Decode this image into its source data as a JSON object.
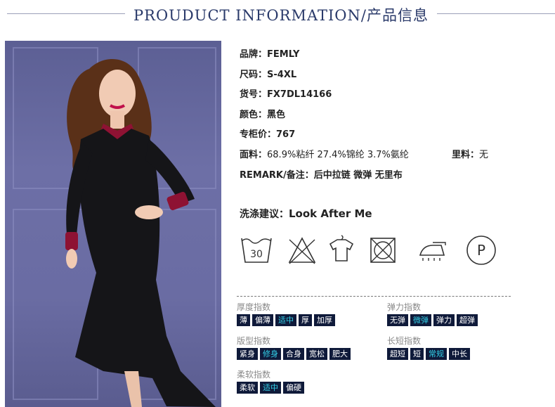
{
  "header": {
    "title": "PROUDUCT INFORMATION/产品信息"
  },
  "product": {
    "brand_label": "品牌：",
    "brand": "FEMLY",
    "size_label": "尺码：",
    "size": "S-4XL",
    "item_no_label": "货号：",
    "item_no": "FX7DL14166",
    "color_label": "颜色：",
    "color": "黑色",
    "price_label": "专柜价：",
    "price": "767",
    "fabric_label": "面料：",
    "fabric": "68.9%粘纤 27.4%锦纶 3.7%氨纶",
    "lining_label": "里料：",
    "lining": "无",
    "remark_label": "REMARK/备注：",
    "remark": "后中拉链 微弹 无里布"
  },
  "care": {
    "label": "洗涤建议：",
    "value": "Look After Me",
    "icons": [
      "wash-30-icon",
      "no-bleach-icon",
      "hang-dry-icon",
      "no-tumble-dry-icon",
      "iron-steam-icon",
      "dry-clean-p-icon"
    ],
    "wash_temp": "30",
    "dry_clean_letter": "P"
  },
  "indices": {
    "thickness": {
      "title": "厚度指数",
      "options": [
        "薄",
        "偏薄",
        "适中",
        "厚",
        "加厚"
      ],
      "selected": "适中"
    },
    "elasticity": {
      "title": "弹力指数",
      "options": [
        "无弹",
        "微弹",
        "弹力",
        "超弹"
      ],
      "selected": "微弹"
    },
    "fit": {
      "title": "版型指数",
      "options": [
        "紧身",
        "修身",
        "合身",
        "宽松",
        "肥大"
      ],
      "selected": "修身"
    },
    "length": {
      "title": "长短指数",
      "options": [
        "超短",
        "短",
        "常规",
        "中长"
      ],
      "selected": "常规"
    },
    "softness": {
      "title": "柔软指数",
      "options": [
        "柔软",
        "适中",
        "偏硬"
      ],
      "selected": "适中"
    }
  },
  "colors": {
    "header_text": "#2a3a6a",
    "chip_bg": "#0f1a3a",
    "chip_active": "#33d0e8"
  }
}
